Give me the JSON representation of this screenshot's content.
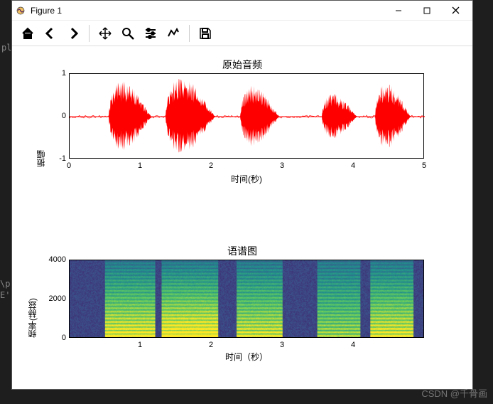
{
  "window": {
    "title": "Figure 1"
  },
  "toolbar": {
    "home": "home-icon",
    "back": "back-icon",
    "forward": "forward-icon",
    "pan": "pan-icon",
    "zoom": "zoom-icon",
    "configure": "configure-icon",
    "axes": "axes-icon",
    "save": "save-icon"
  },
  "watermark": "CSDN @千骨画",
  "bg_code": {
    "line1": "pl",
    "line2": "\\p",
    "line3": "E'"
  },
  "chart_data": [
    {
      "type": "line",
      "title": "原始音频",
      "xlabel": "时间(秒)",
      "ylabel": "振幅",
      "xlim": [
        0,
        5
      ],
      "ylim": [
        -1,
        1
      ],
      "xticks": [
        0,
        1,
        2,
        3,
        4,
        5
      ],
      "yticks": [
        -1,
        0,
        1
      ],
      "color": "#ff0000",
      "description": "Audio waveform: near-silent baseline with five distinct amplitude bursts",
      "bursts": [
        {
          "start": 0.55,
          "end": 1.15,
          "peak": 0.85
        },
        {
          "start": 1.35,
          "end": 2.05,
          "peak": 0.95
        },
        {
          "start": 2.4,
          "end": 2.95,
          "peak": 0.75
        },
        {
          "start": 3.55,
          "end": 4.05,
          "peak": 0.55
        },
        {
          "start": 4.3,
          "end": 4.8,
          "peak": 0.8
        }
      ]
    },
    {
      "type": "heatmap",
      "title": "语谱图",
      "xlabel": "时间（秒）",
      "ylabel": "频率(赫兹)",
      "xlim": [
        0,
        5
      ],
      "ylim": [
        0,
        4000
      ],
      "xticks": [
        1,
        2,
        3,
        4
      ],
      "yticks": [
        0,
        2000,
        4000
      ],
      "colormap": "viridis",
      "description": "Spectrogram with energy bands (yellow/green) aligned with waveform bursts; harmonic striations visible in low frequencies during speech segments"
    }
  ]
}
